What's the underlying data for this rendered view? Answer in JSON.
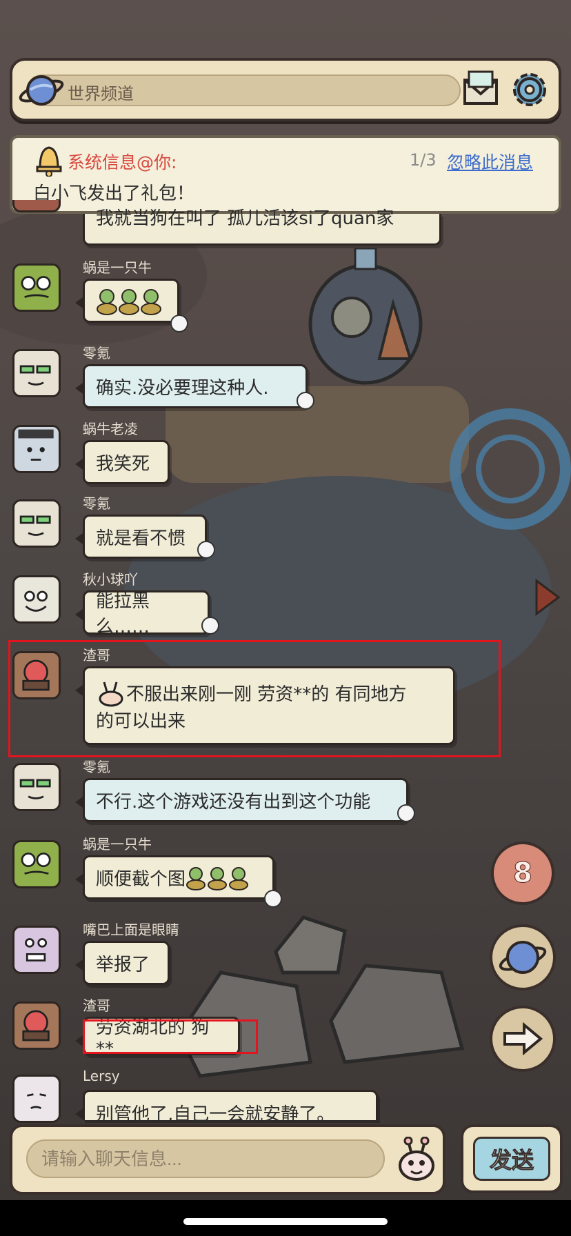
{
  "header": {
    "channel_name": "世界频道"
  },
  "system_notice": {
    "title": "系统信息@你:",
    "count": "1/3",
    "ignore_label": "忽略此消息",
    "body": "白小飞发出了礼包！"
  },
  "messages": [
    {
      "user": "",
      "text": "我就当狗在叫了 孤儿活该si了quan家"
    },
    {
      "user": "蜗是一只牛",
      "text": ""
    },
    {
      "user": "零氪",
      "text": "确实.没必要理这种人."
    },
    {
      "user": "蜗牛老凌",
      "text": "我笑死"
    },
    {
      "user": "零氪",
      "text": "就是看不惯"
    },
    {
      "user": "秋小球吖",
      "text": "能拉黑么……"
    },
    {
      "user": "渣哥",
      "text": "不服出来刚一刚 劳资**的 有同地方",
      "text2": "的可以出来"
    },
    {
      "user": "零氪",
      "text": "不行.这个游戏还没有出到这个功能"
    },
    {
      "user": "蜗是一只牛",
      "text": "顺便截个图"
    },
    {
      "user": "嘴巴上面是眼睛",
      "text": "举报了"
    },
    {
      "user": "渣哥",
      "text": "劳资湖北的 狗**"
    },
    {
      "user": "Lersy",
      "text": "别管他了,自己一会就安静了。"
    }
  ],
  "side_buttons": {
    "badge_count": "8"
  },
  "input": {
    "placeholder": "请输入聊天信息..."
  },
  "send_label": "发送",
  "colors": {
    "frame": "#efe2c2",
    "outline": "#3a2f2b",
    "highlight_box": "#e3141e",
    "link": "#3d6ccd",
    "system_title": "#d9473d"
  }
}
